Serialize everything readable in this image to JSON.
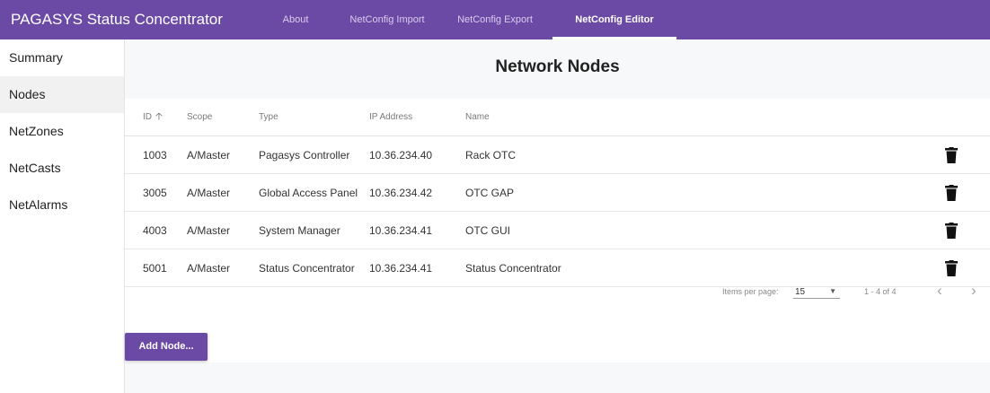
{
  "app": {
    "title": "PAGASYS Status Concentrator"
  },
  "tabs": [
    {
      "label": "About"
    },
    {
      "label": "NetConfig Import"
    },
    {
      "label": "NetConfig Export"
    },
    {
      "label": "NetConfig Editor",
      "active": true
    }
  ],
  "sidebar": {
    "items": [
      {
        "label": "Summary"
      },
      {
        "label": "Nodes",
        "active": true
      },
      {
        "label": "NetZones"
      },
      {
        "label": "NetCasts"
      },
      {
        "label": "NetAlarms"
      }
    ]
  },
  "main": {
    "title": "Network Nodes",
    "columns": {
      "id": "ID",
      "scope": "Scope",
      "type": "Type",
      "ip": "IP Address",
      "name": "Name"
    },
    "sort_icon": "arrow-up-icon",
    "delete_icon": "trash-icon",
    "rows": [
      {
        "id": "1003",
        "scope": "A/Master",
        "type": "Pagasys Controller",
        "ip": "10.36.234.40",
        "name": "Rack OTC"
      },
      {
        "id": "3005",
        "scope": "A/Master",
        "type": "Global Access Panel",
        "ip": "10.36.234.42",
        "name": "OTC GAP"
      },
      {
        "id": "4003",
        "scope": "A/Master",
        "type": "System Manager",
        "ip": "10.36.234.41",
        "name": "OTC GUI"
      },
      {
        "id": "5001",
        "scope": "A/Master",
        "type": "Status Concentrator",
        "ip": "10.36.234.41",
        "name": "Status Concentrator"
      }
    ],
    "paginator": {
      "items_per_page_label": "Items per page:",
      "items_per_page": "15",
      "range": "1 - 4 of 4"
    },
    "add_button": "Add Node..."
  },
  "colors": {
    "accent": "#6b4aa6",
    "background": "#f7f8fa"
  }
}
